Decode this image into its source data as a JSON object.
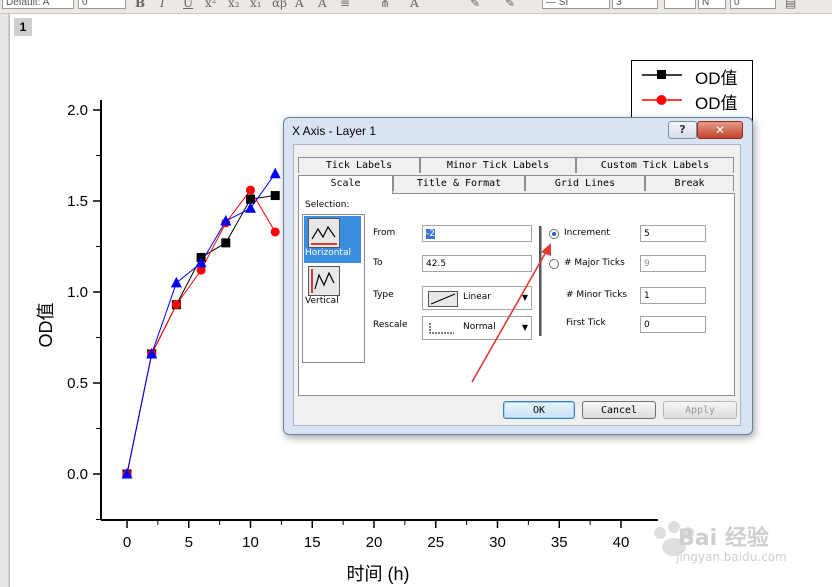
{
  "toolbar": {
    "font_name": "Default: A",
    "font_size": "0",
    "line_style_label": "— SI",
    "line_width": "3",
    "fill_label": "N",
    "pattern_value": "0",
    "bold_icon": "bold-icon",
    "italic_icon": "italic-icon",
    "underline_icon": "underline-icon"
  },
  "graph": {
    "layer_number": "1",
    "x_axis_title": "时间 (h)",
    "y_axis_title": "OD值",
    "legend": [
      {
        "label": "OD值",
        "color": "#000000",
        "marker": "square"
      },
      {
        "label": "OD值",
        "color": "#ff0000",
        "marker": "circle"
      }
    ]
  },
  "chart_data": {
    "type": "line",
    "title": "",
    "xlabel": "时间 (h)",
    "ylabel": "OD值",
    "xlim": [
      -2,
      42.5
    ],
    "ylim": [
      -0.25,
      2.0
    ],
    "x_ticks": [
      "0",
      "5",
      "10",
      "15",
      "20",
      "25",
      "30",
      "35",
      "40"
    ],
    "y_ticks": [
      "0.0",
      "0.5",
      "1.0",
      "1.5",
      "2.0"
    ],
    "grid": false,
    "legend_position": "top-right",
    "series": [
      {
        "name": "OD值",
        "color": "#000000",
        "marker": "square",
        "x": [
          0,
          2,
          4,
          6,
          8,
          10,
          12
        ],
        "y": [
          0.0,
          0.66,
          0.93,
          1.19,
          1.27,
          1.51,
          1.53
        ]
      },
      {
        "name": "OD值",
        "color": "#ff0000",
        "marker": "circle",
        "x": [
          0,
          2,
          4,
          6,
          8,
          10,
          12
        ],
        "y": [
          0.0,
          0.66,
          0.93,
          1.12,
          1.38,
          1.56,
          1.33
        ]
      },
      {
        "color": "#0000ff",
        "marker": "triangle",
        "x": [
          0,
          2,
          4,
          6,
          8,
          10,
          12
        ],
        "y": [
          0.0,
          0.66,
          1.05,
          1.16,
          1.39,
          1.46,
          1.65
        ]
      }
    ]
  },
  "dialog": {
    "title": "X Axis - Layer 1",
    "help_label": "?",
    "close_label": "✕",
    "tabs_back": [
      "Tick Labels",
      "Minor Tick Labels",
      "Custom Tick Labels"
    ],
    "tabs_front": [
      "Scale",
      "Title & Format",
      "Grid Lines",
      "Break"
    ],
    "selection_label": "Selection:",
    "selection_items": [
      "Horizontal",
      "Vertical"
    ],
    "from_label": "From",
    "from_value": "-2",
    "to_label": "To",
    "to_value": "42.5",
    "type_label": "Type",
    "type_value": "Linear",
    "rescale_label": "Rescale",
    "rescale_value": "Normal",
    "increment_label": "Increment",
    "increment_value": "5",
    "major_ticks_label": "# Major Ticks",
    "major_ticks_value": "9",
    "minor_ticks_label": "# Minor Ticks",
    "minor_ticks_value": "1",
    "first_tick_label": "First Tick",
    "first_tick_value": "0",
    "ok_label": "OK",
    "cancel_label": "Cancel",
    "apply_label": "Apply"
  },
  "watermark": {
    "text": "Bai 经验",
    "url": "jingyan.baidu.com"
  }
}
